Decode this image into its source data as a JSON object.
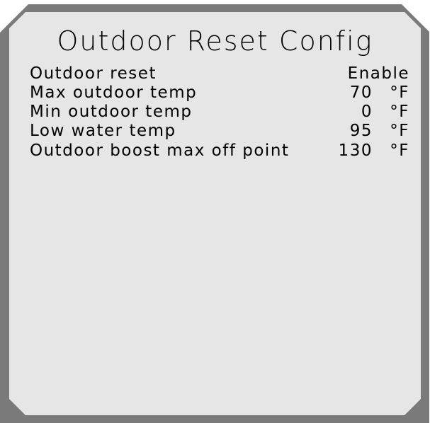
{
  "screen": {
    "title": "Outdoor Reset Config",
    "colors": {
      "bezel": "#7a7a7a",
      "panel": "#e6e6e6",
      "text": "#000000"
    }
  },
  "settings": [
    {
      "label": "Outdoor reset",
      "value": "Enable",
      "unit": ""
    },
    {
      "label": "Max outdoor temp",
      "value": "70",
      "unit": "°F"
    },
    {
      "label": "Min outdoor temp",
      "value": "0",
      "unit": "°F"
    },
    {
      "label": "Low water temp",
      "value": "95",
      "unit": "°F"
    },
    {
      "label": "Outdoor boost max off point",
      "value": "130",
      "unit": "°F"
    }
  ]
}
